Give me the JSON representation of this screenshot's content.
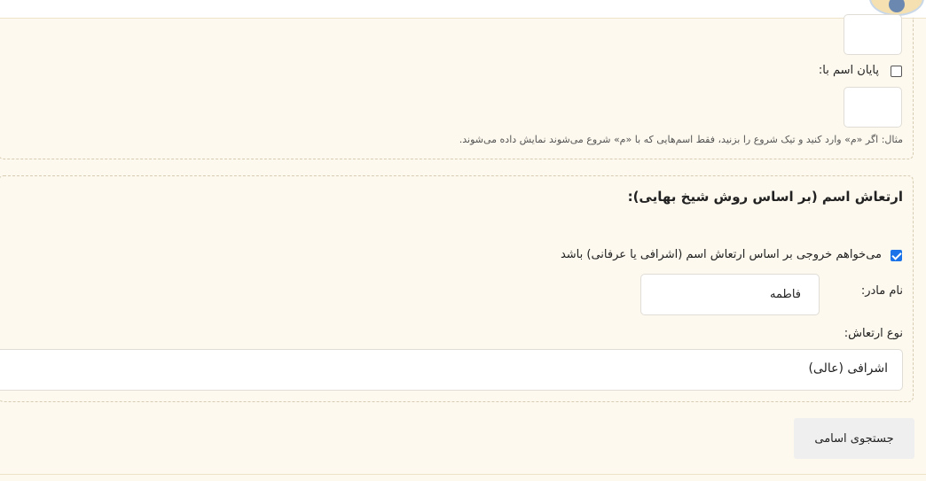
{
  "name_filter": {
    "ends_with_label": "پایان اسم با:",
    "hint": "مثال: اگر «م» وارد کنید و تیک شروع را بزنید، فقط اسم‌هایی که با «م» شروع می‌شوند نمایش داده می‌شوند."
  },
  "vibration": {
    "heading": "ارتعاش اسم (بر اساس روش شیخ بهایی):",
    "checkbox_label": "می‌خواهم خروجی بر اساس ارتعاش اسم (اشرافی یا عرفانی) باشد",
    "mother_name_label": "نام مادر:",
    "mother_name_value": "فاطمه",
    "vibration_type_label": "نوع ارتعاش:",
    "vibration_type_value": "اشرافی (عالی)"
  },
  "search_button_label": "جستجوی اسامی",
  "accent_color": "#1a73e8"
}
